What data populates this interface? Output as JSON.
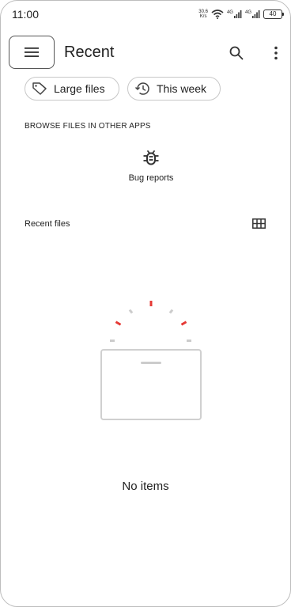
{
  "status_bar": {
    "time": "11:00",
    "net_speed_value": "30.6",
    "net_speed_unit": "K/s",
    "signal_1_label": "4G",
    "signal_2_label": "4G",
    "battery": "40"
  },
  "app_bar": {
    "title": "Recent",
    "menu_icon": "hamburger-menu-icon",
    "search_icon": "search-icon",
    "more_icon": "more-vert-icon"
  },
  "filters": {
    "chips": [
      {
        "label": "Large files",
        "icon": "tag-icon"
      },
      {
        "label": "This week",
        "icon": "history-icon"
      }
    ]
  },
  "browse": {
    "heading": "BROWSE FILES IN OTHER APPS",
    "apps": [
      {
        "label": "Bug reports",
        "icon": "bug-icon"
      }
    ]
  },
  "recent_files": {
    "label": "Recent files",
    "view_toggle_icon": "grid-view-icon",
    "empty_message": "No items"
  },
  "colors": {
    "accent_red": "#e53935",
    "illustration_gray": "#d0d0d0",
    "border": "#c7c7c7"
  }
}
